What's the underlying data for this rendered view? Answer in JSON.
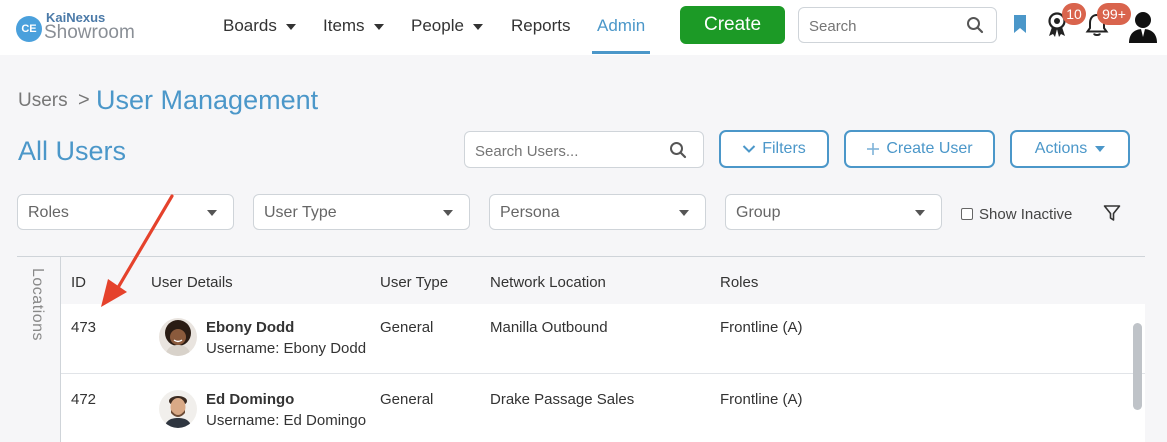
{
  "brand": {
    "logo_mark": "CE",
    "line1": "KaiNexus",
    "line2": "Showroom"
  },
  "nav": {
    "items": [
      {
        "label": "Boards",
        "has_caret": true
      },
      {
        "label": "Items",
        "has_caret": true
      },
      {
        "label": "People",
        "has_caret": true
      },
      {
        "label": "Reports",
        "has_caret": false
      },
      {
        "label": "Admin",
        "has_caret": false,
        "active": true
      }
    ],
    "create_label": "Create",
    "search_placeholder": "Search",
    "award_badge": "10",
    "notifications_badge": "99+"
  },
  "breadcrumb": {
    "parent": "Users",
    "separator": ">",
    "current": "User Management"
  },
  "page_title": "All Users",
  "toolbar": {
    "search_placeholder": "Search Users...",
    "filters_label": "Filters",
    "create_user_label": "Create User",
    "actions_label": "Actions"
  },
  "filters": {
    "roles": "Roles",
    "user_type": "User Type",
    "persona": "Persona",
    "group": "Group",
    "show_inactive_label": "Show Inactive",
    "show_inactive_checked": false
  },
  "side_panel": {
    "label": "Locations"
  },
  "table": {
    "columns": [
      "ID",
      "User Details",
      "User Type",
      "Network Location",
      "Roles"
    ],
    "rows": [
      {
        "id": "473",
        "name": "Ebony Dodd",
        "username": "Username: Ebony Dodd",
        "user_type": "General",
        "network_location": "Manilla Outbound",
        "roles": "Frontline (A)"
      },
      {
        "id": "472",
        "name": "Ed Domingo",
        "username": "Username: Ed Domingo",
        "user_type": "General",
        "network_location": "Drake Passage Sales",
        "roles": "Frontline (A)"
      }
    ]
  },
  "colors": {
    "accent": "#4b97c9",
    "create_green": "#1c9a26",
    "badge_red": "#d9644d",
    "annotation_arrow": "#e5422c"
  },
  "icons": [
    "search-icon",
    "bookmark-icon",
    "award-icon",
    "bell-icon",
    "user-avatar-icon",
    "chevron-down-icon",
    "plus-icon",
    "filter-funnel-icon",
    "caret-down-icon"
  ]
}
